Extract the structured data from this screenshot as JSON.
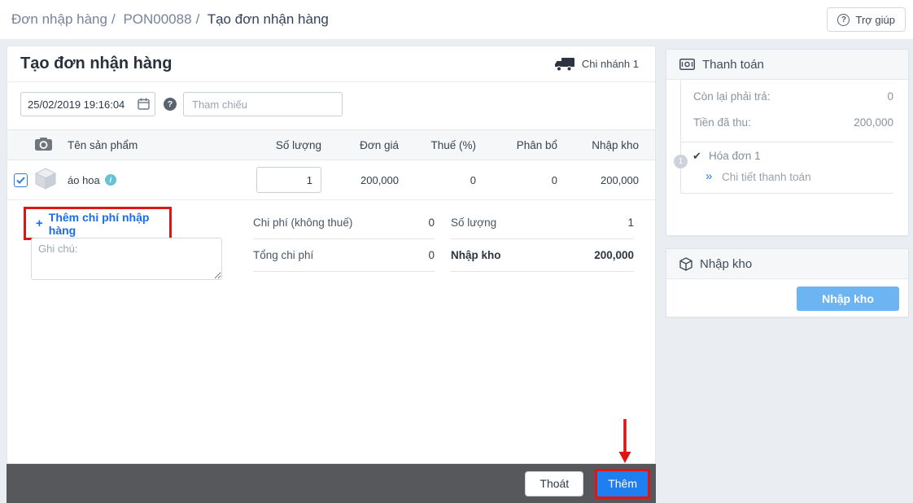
{
  "colors": {
    "accent_blue": "#1a6ced",
    "primary_button_blue": "#1f7ef0",
    "light_button_blue": "#6db4f2",
    "annotation_red": "#dd1616",
    "footer_bar_gray": "#56585b"
  },
  "icons": {
    "question": "?",
    "plus": "+",
    "info": "i",
    "check": "✔",
    "double_chevron": "»"
  },
  "breadcrumb": {
    "section": "Đơn nhập hàng",
    "sep1": "/",
    "order_code": "PON00088",
    "sep2": "/",
    "current": "Tạo đơn nhận hàng"
  },
  "topbar": {
    "help": "Trợ giúp"
  },
  "main": {
    "title": "Tạo đơn nhận hàng",
    "branch": "Chi nhánh 1",
    "date_value": "25/02/2019 19:16:04",
    "reference_placeholder": "Tham chiếu",
    "notes_placeholder": "Ghi chú:",
    "add_cost_label": "Thêm chi phí nhập hàng"
  },
  "table": {
    "headers": {
      "product": "Tên sản phẩm",
      "quantity": "Số lượng",
      "unit_price": "Đơn giá",
      "tax": "Thuế (%)",
      "allocation": "Phân bổ",
      "stock_in": "Nhập kho"
    },
    "row": {
      "name": "áo hoa",
      "quantity": "1",
      "unit_price": "200,000",
      "tax": "0",
      "allocation": "0",
      "stock_in": "200,000"
    }
  },
  "summary": {
    "rows": [
      {
        "label": "Chi phí (không thuế)",
        "value": "0"
      },
      {
        "label": "Tổng chi phí",
        "value": "0"
      },
      {
        "label": "Số lượng",
        "value": "1"
      },
      {
        "label": "Nhập kho",
        "value": "200,000"
      }
    ]
  },
  "payment": {
    "title": "Thanh toán",
    "remaining_label": "Còn lại phải trả:",
    "remaining_value": "0",
    "received_label": "Tiền đã thu:",
    "received_value": "200,000",
    "step_number": "1",
    "invoice_label": "Hóa đơn 1",
    "detail_link": "Chi tiết thanh toán"
  },
  "stock": {
    "title": "Nhập kho",
    "button": "Nhập kho"
  },
  "footer": {
    "exit": "Thoát",
    "add": "Thêm"
  }
}
